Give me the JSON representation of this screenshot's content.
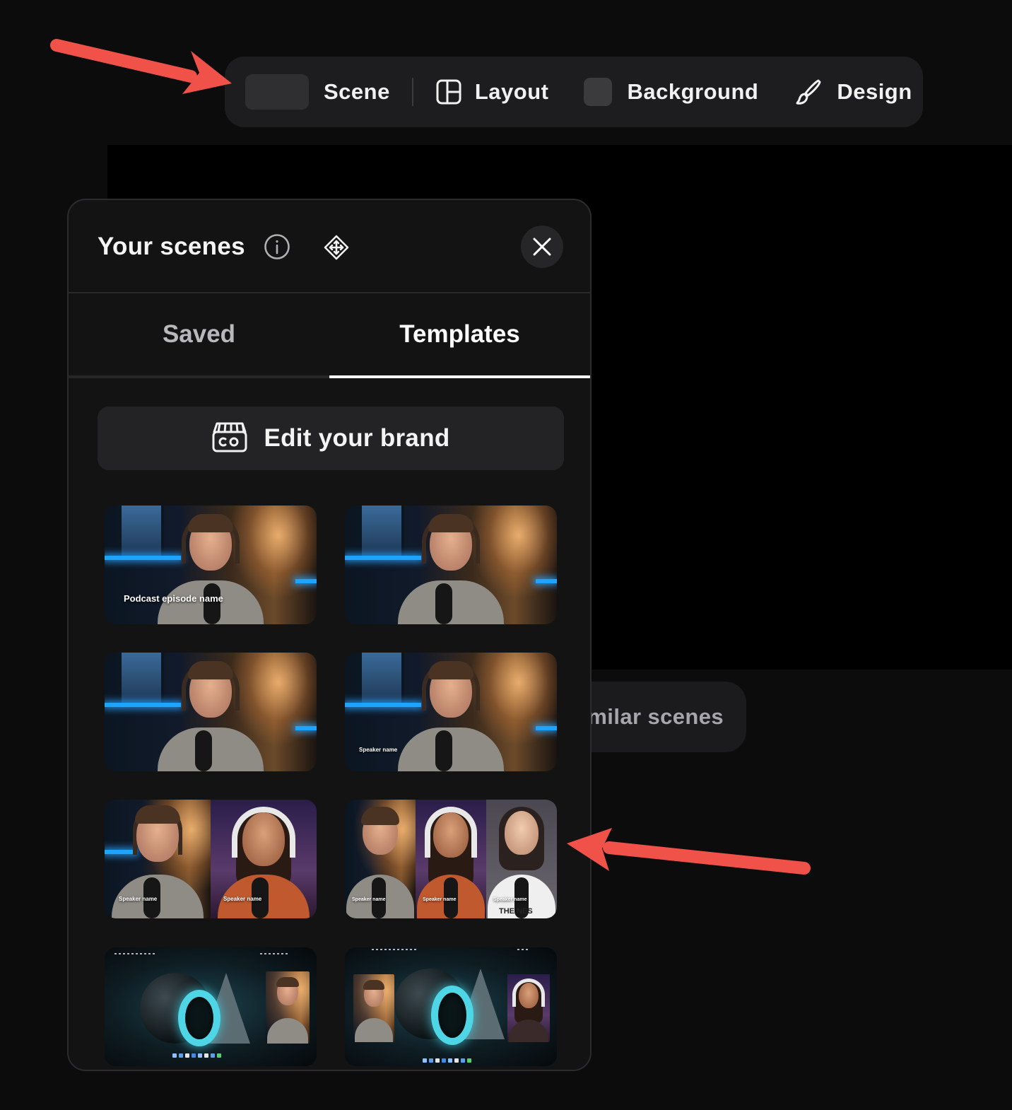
{
  "toolbar": {
    "scene_label": "Scene",
    "layout_label": "Layout",
    "background_label": "Background",
    "design_label": "Design"
  },
  "stage": {
    "similar_scenes_label": "milar scenes"
  },
  "panel": {
    "title": "Your scenes",
    "tabs": [
      {
        "label": "Saved",
        "active": false
      },
      {
        "label": "Templates",
        "active": true
      }
    ],
    "edit_brand_label": "Edit your brand",
    "templates": [
      {
        "caption": "Podcast episode name"
      },
      {
        "caption": ""
      },
      {
        "caption": ""
      },
      {
        "caption": "Speaker name"
      },
      {
        "captions": [
          "Speaker name",
          "Speaker name"
        ]
      },
      {
        "captions": [
          "Speaker name",
          "Speaker name",
          "Speaker name"
        ],
        "badge": "THE NES"
      },
      {
        "caption": ""
      },
      {
        "caption": ""
      }
    ]
  },
  "colors": {
    "background": "#0c0c0d",
    "panel": "#131314",
    "toolbar": "#1d1d1f",
    "annotation_arrow": "#f0524a",
    "active_tab_underline": "#ffffff"
  },
  "icons": {
    "layout": "layout-grid-icon",
    "design": "paintbrush-icon",
    "info": "info-icon",
    "move": "move-drag-icon",
    "close": "close-icon",
    "brand": "brand-camera-icon"
  }
}
